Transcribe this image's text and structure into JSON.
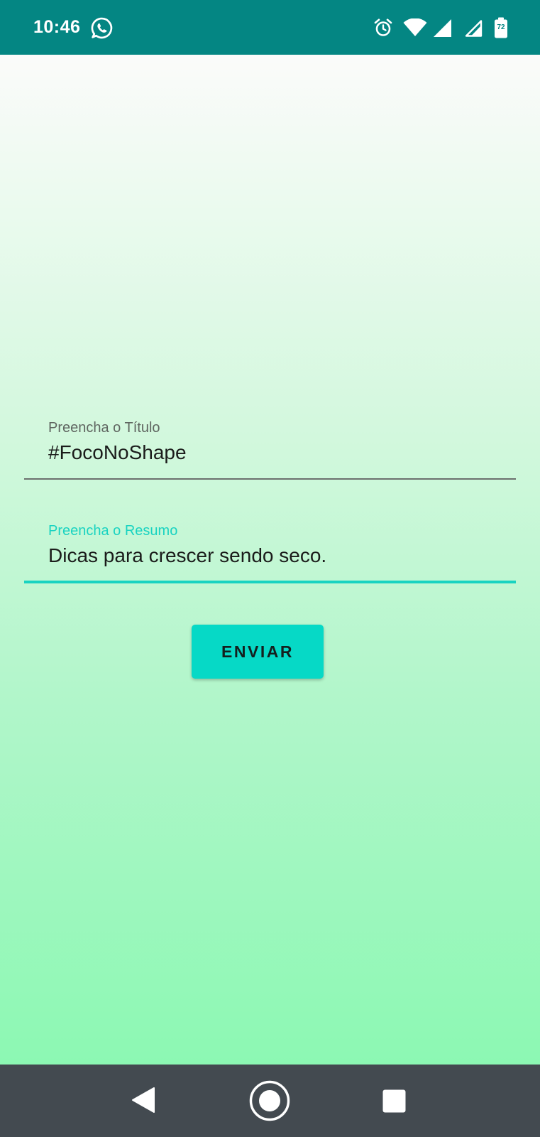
{
  "status_bar": {
    "time": "10:46",
    "battery_level": "72",
    "background_color": "#048683",
    "icons": [
      "whatsapp-icon",
      "alarm-icon",
      "wifi-icon",
      "signal-icon",
      "signal-icon",
      "battery-icon"
    ]
  },
  "form": {
    "title_field": {
      "label": "Preencha o Título",
      "value": "#FocoNoShape"
    },
    "summary_field": {
      "label": "Preencha o Resumo",
      "value": "Dicas para crescer sendo seco.",
      "focused": true
    },
    "submit_label": "ENVIAR"
  },
  "nav_bar": {
    "buttons": [
      "back-icon",
      "home-icon",
      "recents-icon"
    ]
  },
  "colors": {
    "accent": "#06d9c6",
    "focused_label": "#19d3c1",
    "unfocused_label": "#5f6560",
    "gradient_top": "#fbfbfa",
    "gradient_bottom": "#8cf8b3",
    "nav_background": "#434a50"
  }
}
